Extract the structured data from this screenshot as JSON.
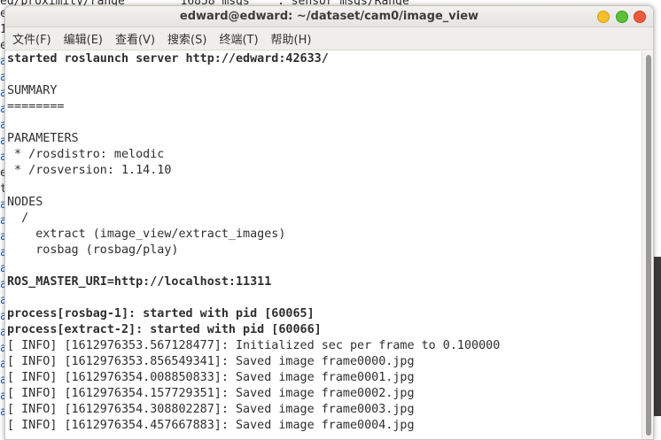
{
  "background_terminal": {
    "top_text": "ed/proximity/range        16858 msgs    : sensor_msgs/Range",
    "left_chars": [
      "e",
      "1",
      "e",
      "a",
      "a",
      "a",
      "a",
      "a",
      "a",
      "a",
      "e",
      "t",
      "a",
      "a",
      "a",
      "a",
      "a",
      "a",
      "a",
      "a",
      "a",
      "a",
      "a",
      "a",
      "a",
      "a"
    ]
  },
  "window": {
    "title": "edward@edward: ~/dataset/cam0/image_view"
  },
  "menu": {
    "items": [
      "文件(F)",
      "编辑(E)",
      "查看(V)",
      "搜索(S)",
      "终端(T)",
      "帮助(H)"
    ]
  },
  "terminal": {
    "lines": [
      {
        "text": "started roslaunch server http://edward:42633/",
        "bold": true
      },
      {
        "text": "",
        "bold": false
      },
      {
        "text": "SUMMARY",
        "bold": false
      },
      {
        "text": "========",
        "bold": false
      },
      {
        "text": "",
        "bold": false
      },
      {
        "text": "PARAMETERS",
        "bold": false
      },
      {
        "text": " * /rosdistro: melodic",
        "bold": false
      },
      {
        "text": " * /rosversion: 1.14.10",
        "bold": false
      },
      {
        "text": "",
        "bold": false
      },
      {
        "text": "NODES",
        "bold": false
      },
      {
        "text": "  /",
        "bold": false
      },
      {
        "text": "    extract (image_view/extract_images)",
        "bold": false
      },
      {
        "text": "    rosbag (rosbag/play)",
        "bold": false
      },
      {
        "text": "",
        "bold": false
      },
      {
        "text": "ROS_MASTER_URI=http://localhost:11311",
        "bold": true
      },
      {
        "text": "",
        "bold": false
      },
      {
        "text": "process[rosbag-1]: started with pid [60065]",
        "bold": true
      },
      {
        "text": "process[extract-2]: started with pid [60066]",
        "bold": true
      },
      {
        "text": "[ INFO] [1612976353.567128477]: Initialized sec per frame to 0.100000",
        "bold": false
      },
      {
        "text": "[ INFO] [1612976353.856549341]: Saved image frame0000.jpg",
        "bold": false
      },
      {
        "text": "[ INFO] [1612976354.008850833]: Saved image frame0001.jpg",
        "bold": false
      },
      {
        "text": "[ INFO] [1612976354.157729351]: Saved image frame0002.jpg",
        "bold": false
      },
      {
        "text": "[ INFO] [1612976354.308802287]: Saved image frame0003.jpg",
        "bold": false
      },
      {
        "text": "[ INFO] [1612976354.457667883]: Saved image frame0004.jpg",
        "bold": false
      }
    ]
  },
  "colors": {
    "minimize": "#f4bf2a",
    "maximize": "#5bc236",
    "close": "#ef5a3f"
  }
}
